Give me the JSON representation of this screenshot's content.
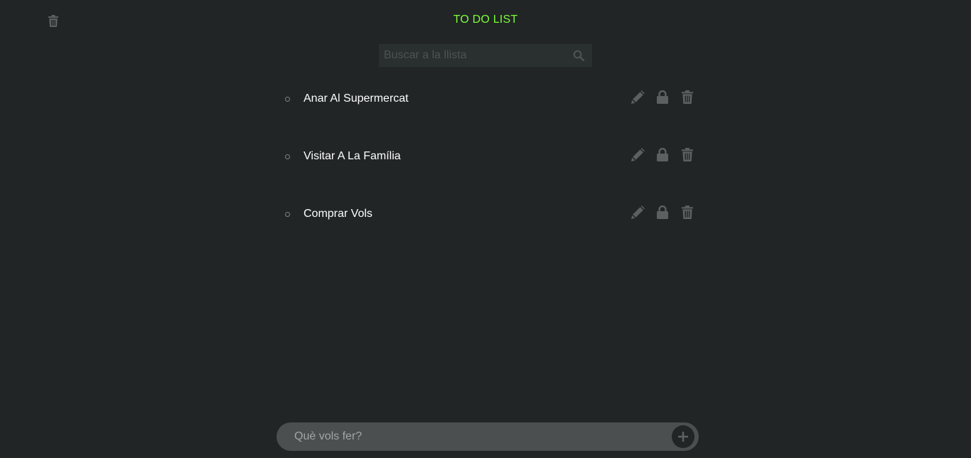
{
  "header": {
    "title": "TO DO LIST",
    "clear_icon": "trash-icon"
  },
  "search": {
    "placeholder": "Buscar a la llista",
    "value": "",
    "icon": "search-icon"
  },
  "tasks": [
    {
      "label": "Anar Al Supermercat",
      "actions": [
        "pencil-icon",
        "lock-icon",
        "trash-icon"
      ]
    },
    {
      "label": "Visitar A La Família",
      "actions": [
        "pencil-icon",
        "lock-icon",
        "trash-icon"
      ]
    },
    {
      "label": "Comprar Vols",
      "actions": [
        "pencil-icon",
        "lock-icon",
        "trash-icon"
      ]
    }
  ],
  "composer": {
    "placeholder": "Què vols fer?",
    "value": "",
    "add_icon": "plus-icon"
  },
  "colors": {
    "background": "#212525",
    "title": "#7cfc3a",
    "icon": "#5b6060",
    "task_text": "#ffffff",
    "composer_bg": "#4b4f4f"
  }
}
